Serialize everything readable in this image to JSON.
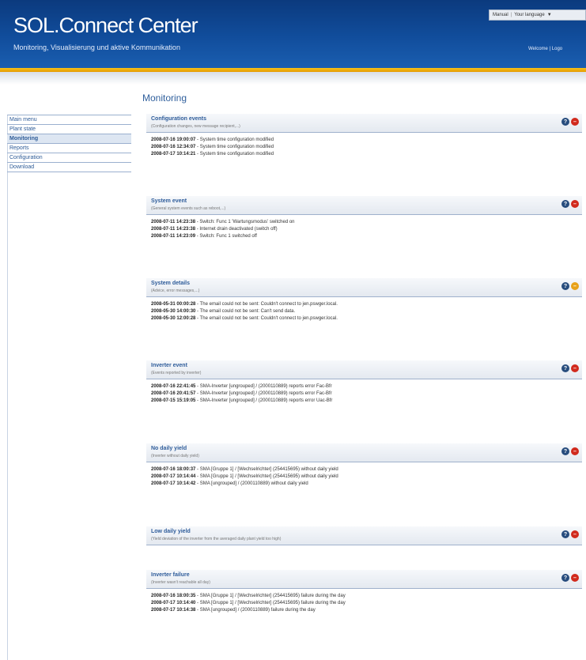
{
  "header": {
    "brand": "SOL.Connect Center",
    "tagline": "Monitoring, Visualisierung und aktive Kommunikation",
    "top_links": {
      "manual": "Manual",
      "language": "Your language",
      "caret": "▼"
    },
    "welcome": "Welcome | Logo"
  },
  "page_title": "Monitoring",
  "menu": [
    {
      "label": "Main menu"
    },
    {
      "label": "Plant state"
    },
    {
      "label": "Monitoring"
    },
    {
      "label": "Reports"
    },
    {
      "label": "Configuration"
    },
    {
      "label": "Download"
    }
  ],
  "active_menu_index": 2,
  "sections": [
    {
      "title": "Configuration events",
      "subtitle": "(Configuration changes, new message recipient,...)",
      "status": "red",
      "rows": [
        {
          "ts": "2008-07-16 19:00:07",
          "text": " - System time configuration modified"
        },
        {
          "ts": "2008-07-16 12:34:07",
          "text": " - System time configuration modified"
        },
        {
          "ts": "2008-07-17 10:14:21",
          "text": " - System time configuration modified"
        }
      ]
    },
    {
      "title": "System event",
      "subtitle": "(General system events such as reboot,...)",
      "status": "red",
      "rows": [
        {
          "ts": "2008-07-11 14:23:38",
          "text": " - Switch: Func 1 'Wartungsmodus' switched on"
        },
        {
          "ts": "2008-07-11 14:23:38",
          "text": " - Internet drain deactivated (switch off)"
        },
        {
          "ts": "2008-07-11 14:23:09",
          "text": " - Switch: Func 1 switched off"
        }
      ]
    },
    {
      "title": "System details",
      "subtitle": "(Advice, error messages,...)",
      "status": "orange",
      "rows": [
        {
          "ts": "2008-05-31 00:00:28",
          "text": " - The email could not be sent: Couldn't connect to jen.pswger.local."
        },
        {
          "ts": "2008-05-30 14:00:30",
          "text": " - The email could not be sent: Can't send data."
        },
        {
          "ts": "2008-05-30 12:00:28",
          "text": " - The email could not be sent: Couldn't connect to jen.pswger.local."
        }
      ]
    },
    {
      "title": "Inverter event",
      "subtitle": "(Events reported by inverter)",
      "status": "red",
      "rows": [
        {
          "ts": "2008-07-16 22:41:45",
          "text": " - SMA-Inverter [ungrouped] / (2000110889) reports error Fac-Bfr"
        },
        {
          "ts": "2008-07-16 20:41:57",
          "text": " - SMA-Inverter [ungrouped] / (2000110889) reports error Fac-Bfr"
        },
        {
          "ts": "2008-07-15 15:19:05",
          "text": " - SMA-Inverter [ungrouped] / (2000110889) reports error Uac-Bfr"
        }
      ]
    },
    {
      "title": "No daily yield",
      "subtitle": "(Inverter without daily yield)",
      "status": "red",
      "rows": [
        {
          "ts": "2008-07-16 18:00:37",
          "text": " - SMA [Gruppe 1] / [Wechselrichter] (254415695) without daily yield"
        },
        {
          "ts": "2008-07-17 10:14:44",
          "text": " - SMA [Gruppe 1] / [Wechselrichter] (254415695) without daily yield"
        },
        {
          "ts": "2008-07-17 10:14:42",
          "text": " - SMA [ungrouped] / (2000110889) without daily yield"
        }
      ]
    },
    {
      "title": "Low daily yield",
      "subtitle": "(Yield deviation of the inverter from the averaged daily plant yield too high)",
      "status": "red",
      "rows": []
    },
    {
      "title": "Inverter failure",
      "subtitle": "(Inverter wasn't reachable all day)",
      "status": "red",
      "rows": [
        {
          "ts": "2008-07-16 18:00:35",
          "text": " - SMA [Gruppe 1] / [Wechselrichter] (254415695) failure during the day"
        },
        {
          "ts": "2008-07-17 10:14:40",
          "text": " - SMA [Gruppe 1] / [Wechselrichter] (254415695) failure during the day"
        },
        {
          "ts": "2008-07-17 10:14:38",
          "text": " - SMA [ungrouped] / (2000110889) failure during the day"
        }
      ]
    }
  ]
}
